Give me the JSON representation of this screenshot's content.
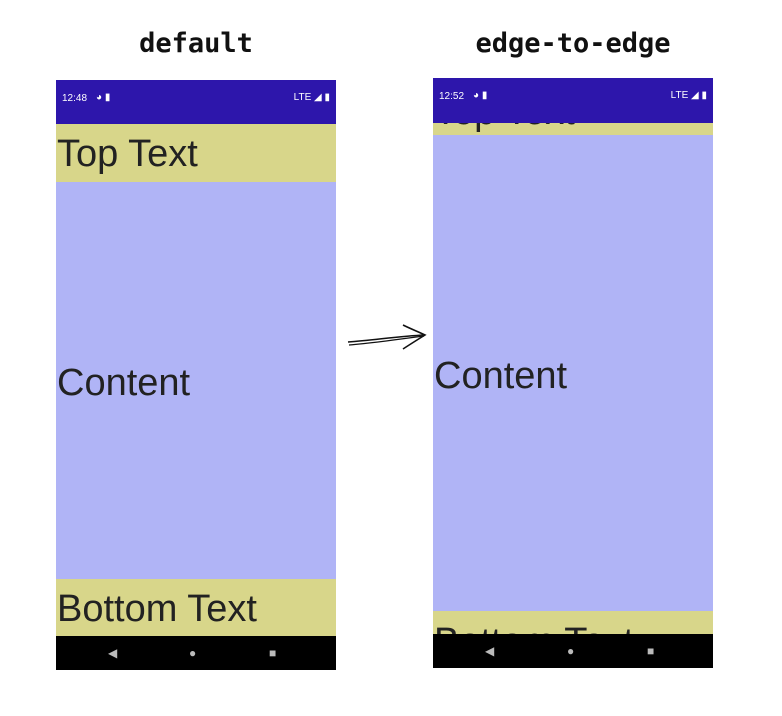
{
  "labels": {
    "left": "default",
    "right": "edge-to-edge"
  },
  "left_phone": {
    "time": "12:48",
    "network": "LTE",
    "top_text": "Top Text",
    "content": "Content",
    "bottom_text": "Bottom Text"
  },
  "right_phone": {
    "time": "12:52",
    "network": "LTE",
    "top_text": "Top Text",
    "content": "Content",
    "bottom_text": "Bottom Text"
  },
  "nav": {
    "back": "◀",
    "home": "●",
    "recents": "■"
  },
  "colors": {
    "status_bar": "#2d16ab",
    "band": "#d8d68a",
    "content": "#b0b4f6",
    "nav_bar": "#000000"
  }
}
